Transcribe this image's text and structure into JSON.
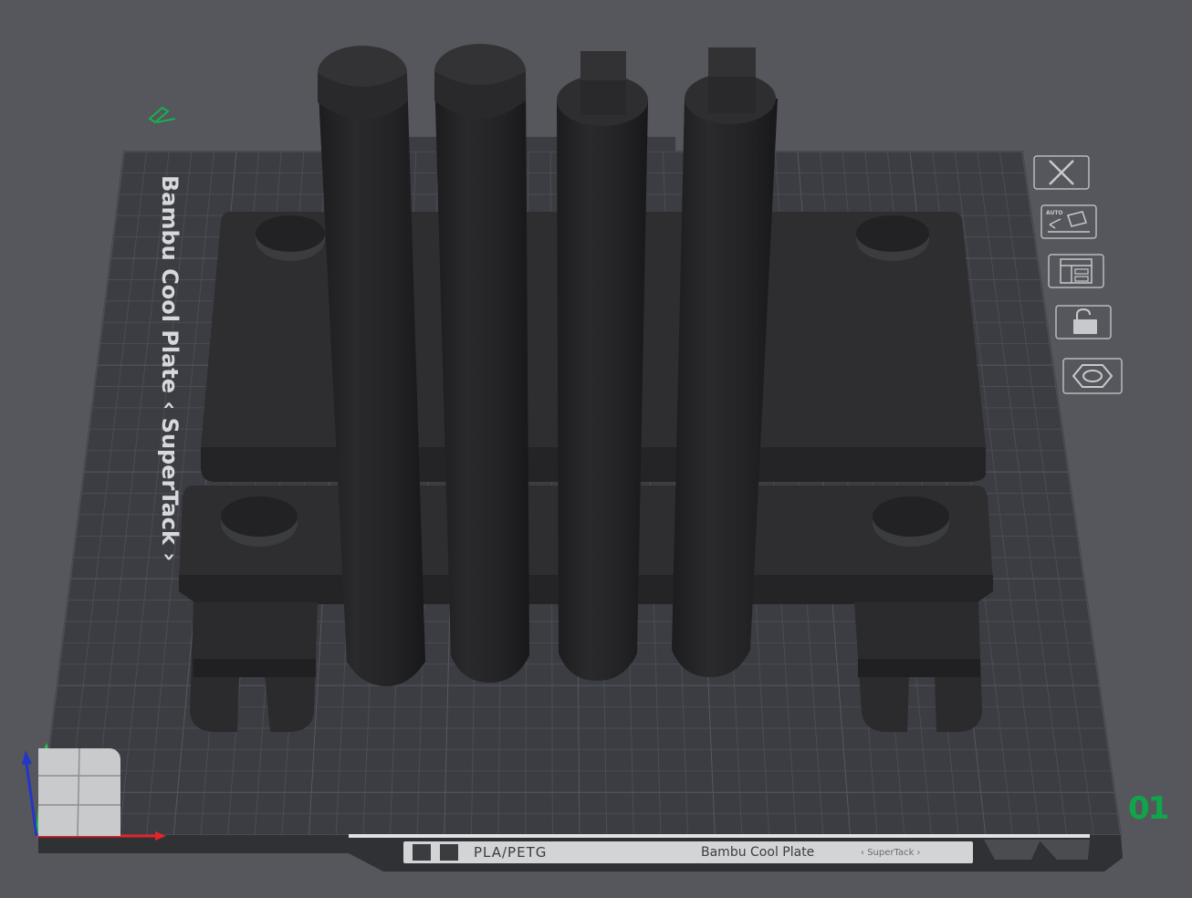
{
  "plate": {
    "side_label": "Bambu Cool Plate",
    "side_sub": "SuperTack",
    "number": "01",
    "material": "PLA/PETG",
    "bottom_name": "Bambu Cool Plate",
    "bottom_sub": "SuperTack"
  },
  "toolbar": {
    "items": [
      {
        "name": "close-plate-button",
        "icon": "close-icon"
      },
      {
        "name": "auto-orient-button",
        "icon": "auto-orient-icon",
        "label": "AUTO"
      },
      {
        "name": "arrange-button",
        "icon": "arrange-icon"
      },
      {
        "name": "lock-plate-button",
        "icon": "lock-icon"
      },
      {
        "name": "plate-settings-button",
        "icon": "hexagon-icon"
      }
    ]
  },
  "colors": {
    "background": "#55575d",
    "plate": "#3b3d42",
    "grid": "#4d4f55",
    "object": "#2b2b2d",
    "plate_number": "#11a54a",
    "axis_x": "#e0262b",
    "axis_y": "#26c044",
    "axis_z": "#2336c8"
  }
}
